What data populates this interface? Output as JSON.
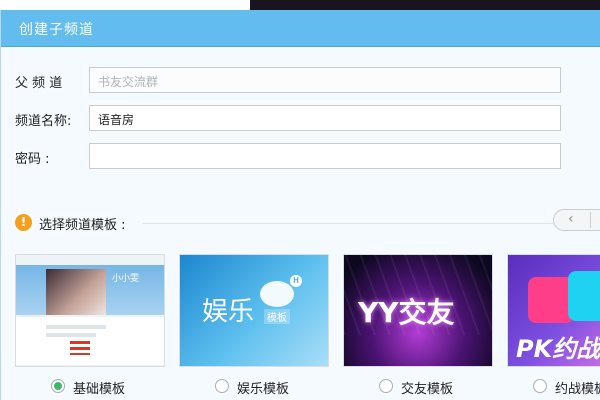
{
  "dialog": {
    "title": "创建子频道"
  },
  "form": {
    "parent_channel": {
      "label": "父 频 道",
      "placeholder": "书友交流群"
    },
    "channel_name": {
      "label": "频道名称:",
      "value": "语音房"
    },
    "password": {
      "label": "密码 :",
      "value": ""
    }
  },
  "templates": {
    "section_label": "选择频道模板 :",
    "warning_glyph": "!",
    "pager_prev_glyph": "‹",
    "items": [
      {
        "label": "基础模板",
        "checked": true,
        "preview_name": "小小雯"
      },
      {
        "label": "娱乐模板",
        "checked": false,
        "preview_main": "娱乐",
        "preview_sub": "模板"
      },
      {
        "label": "交友模板",
        "checked": false,
        "preview_main": "YY交友"
      },
      {
        "label": "约战模板",
        "checked": false,
        "preview_main": "PK约战"
      }
    ]
  },
  "colors": {
    "titlebar": "#62bced",
    "radio_checked": "#3fb76a",
    "warning": "#f3a021"
  }
}
